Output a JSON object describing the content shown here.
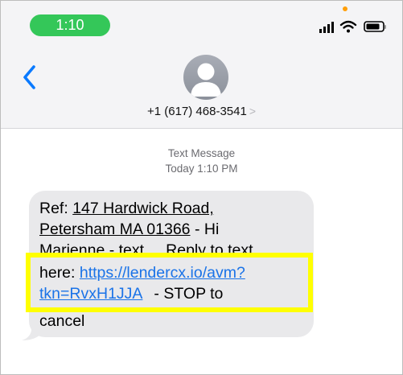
{
  "status_bar": {
    "time": "1:10",
    "icons": [
      "signal-icon",
      "wifi-icon",
      "battery-icon"
    ],
    "time_pill_color": "#34c759",
    "mic_indicator_color": "#ff9f0a"
  },
  "header": {
    "back_icon": "chevron-left-icon",
    "avatar_icon": "person-icon",
    "contact": "+1 (617) 468-3541",
    "contact_chevron": ">"
  },
  "conversation": {
    "type_label": "Text Message",
    "timestamp": "Today 1:10 PM"
  },
  "message": {
    "ref_prefix": "Ref: ",
    "address_line1": "147 Hardwick Road,",
    "address_line2": "Petersham MA 01366",
    "after_address": " - Hi",
    "clipped_line": "Marienne - text ... Reply to text",
    "here_prefix": "here: ",
    "link_line1": "https://lendercx.io/avm?",
    "link_line2": "tkn=RvxH1JJA",
    "stop_text": "- STOP to",
    "cancel_text": "cancel"
  },
  "colors": {
    "highlight": "#ffff00",
    "link": "#1a73e8",
    "bubble": "#e9e9eb"
  }
}
